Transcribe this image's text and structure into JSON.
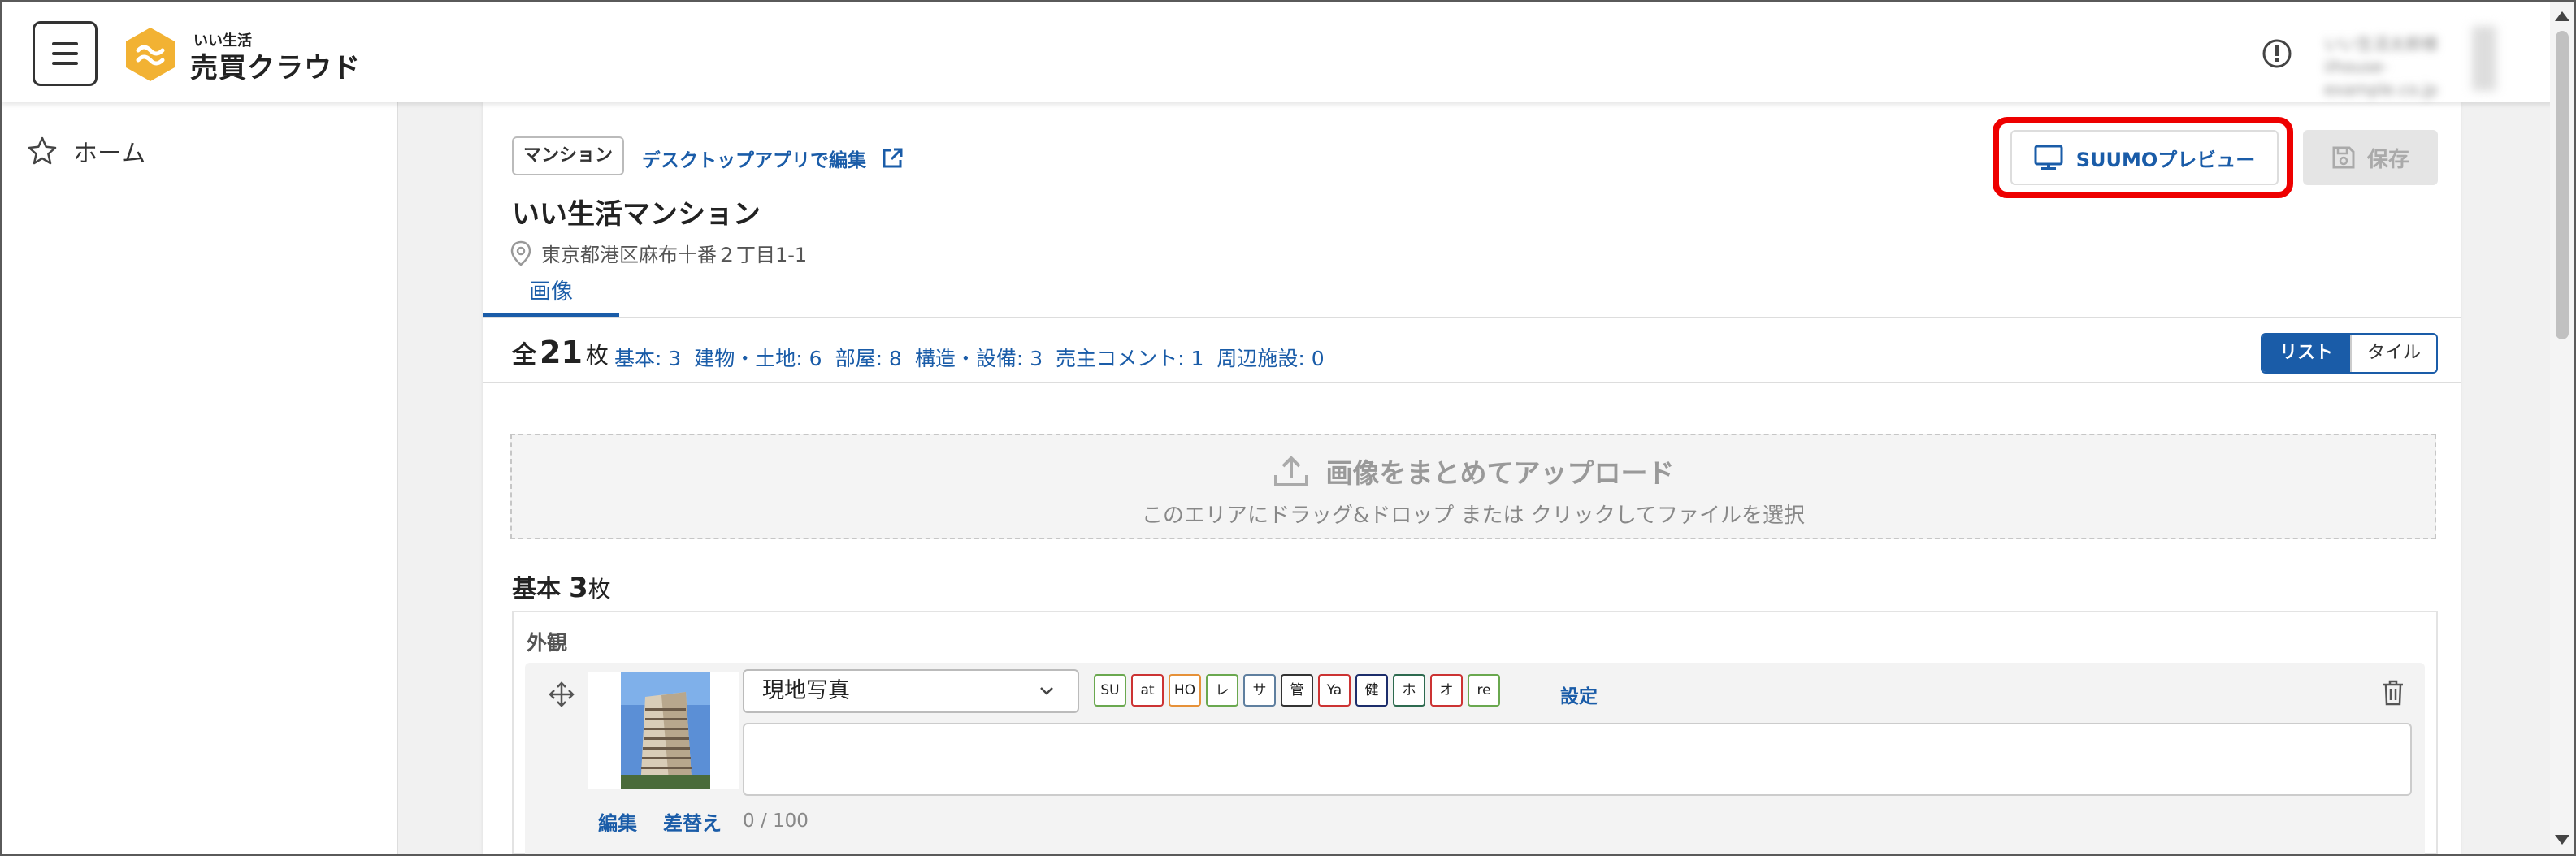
{
  "header": {
    "brand_sub": "いい生活",
    "brand_main": "売買クラウド",
    "user_line1": "いい生活太郎様",
    "user_line2": "iihouse-example.co.jp"
  },
  "sidebar": {
    "items": [
      {
        "label": "ホーム",
        "icon": "star-icon"
      }
    ]
  },
  "property": {
    "type": "マンション",
    "desktop_link": "デスクトップアプリで編集",
    "name": "いい生活マンション",
    "address": "東京都港区麻布十番２丁目1-1"
  },
  "actions": {
    "preview_label": "SUUMOプレビュー",
    "save_label": "保存",
    "highlight_color": "#ee0000"
  },
  "tabs": [
    {
      "label": "画像",
      "active": true
    }
  ],
  "summary": {
    "prefix": "全",
    "total": "21",
    "unit": "枚",
    "categories": [
      "基本: 3",
      "建物・土地: 6",
      "部屋: 8",
      "構造・設備: 3",
      "売主コメント: 1",
      "周辺施設: 0"
    ]
  },
  "view_toggle": {
    "list": "リスト",
    "tile": "タイル",
    "selected": "リスト"
  },
  "upload": {
    "title": "画像をまとめてアップロード",
    "subtitle": "このエリアにドラッグ&ドロップ または クリックしてファイルを選択"
  },
  "section": {
    "name": "基本",
    "count": "3",
    "unit": "枚",
    "group_label": "外観",
    "item": {
      "select_value": "現地写真",
      "tags": [
        {
          "label": "SU",
          "color": "#6aa84f"
        },
        {
          "label": "at",
          "color": "#cc3333"
        },
        {
          "label": "HO",
          "color": "#e69138"
        },
        {
          "label": "レ",
          "color": "#6aa84f"
        },
        {
          "label": "サ",
          "color": "#5f7f9f"
        },
        {
          "label": "管",
          "color": "#333333"
        },
        {
          "label": "Ya",
          "color": "#cc3333"
        },
        {
          "label": "健",
          "color": "#1c2d6b"
        },
        {
          "label": "ホ",
          "color": "#2d6a4f"
        },
        {
          "label": "オ",
          "color": "#cc3333"
        },
        {
          "label": "re",
          "color": "#6aa84f"
        }
      ],
      "settings_link": "設定",
      "edit_link": "編集",
      "replace_link": "差替え",
      "counter": "0 / 100"
    }
  },
  "colors": {
    "accent": "#1a5ca8",
    "logo": "#f2b233"
  }
}
